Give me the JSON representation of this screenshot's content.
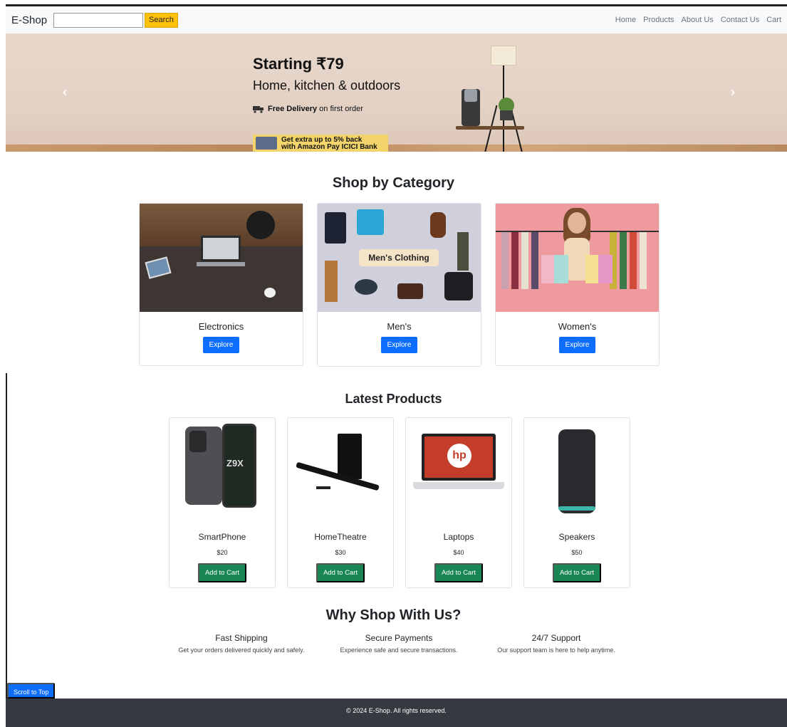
{
  "nav": {
    "brand": "E-Shop",
    "search_placeholder": "",
    "search_button": "Search",
    "links": [
      "Home",
      "Products",
      "About Us",
      "Contact Us",
      "Cart"
    ]
  },
  "hero": {
    "title": "Starting ₹79",
    "subtitle": "Home, kitchen & outdoors",
    "delivery_bold": "Free Delivery",
    "delivery_rest": " on first order",
    "offer_line1": "Get extra up to 5% back",
    "offer_line2": "with Amazon Pay ICICI Bank",
    "prev_arrow": "‹",
    "next_arrow": "›"
  },
  "categories": {
    "title": "Shop by Category",
    "items": [
      {
        "name": "Electronics",
        "button": "Explore"
      },
      {
        "name": "Men's",
        "button": "Explore",
        "banner": "Men's Clothing"
      },
      {
        "name": "Women's",
        "button": "Explore"
      }
    ]
  },
  "products": {
    "title": "Latest Products",
    "items": [
      {
        "name": "SmartPhone",
        "price": "$20",
        "button": "Add to Cart",
        "label": "Z9X"
      },
      {
        "name": "HomeTheatre",
        "price": "$30",
        "button": "Add to Cart"
      },
      {
        "name": "Laptops",
        "price": "$40",
        "button": "Add to Cart",
        "label": "hp"
      },
      {
        "name": "Speakers",
        "price": "$50",
        "button": "Add to Cart"
      }
    ]
  },
  "why": {
    "title": "Why Shop With Us?",
    "features": [
      {
        "title": "Fast Shipping",
        "desc": "Get your orders delivered quickly and safely."
      },
      {
        "title": "Secure Payments",
        "desc": "Experience safe and secure transactions."
      },
      {
        "title": "24/7 Support",
        "desc": "Our support team is here to help anytime."
      }
    ]
  },
  "scroll_button": "Scroll to Top",
  "footer": "© 2024 E-Shop. All rights reserved.",
  "colors": {
    "primary": "#0d6efd",
    "success": "#198754",
    "warning": "#ffc107",
    "footer_bg": "#343a40"
  },
  "icons": {
    "delivery": "truck-icon",
    "prev": "chevron-left-icon",
    "next": "chevron-right-icon"
  }
}
